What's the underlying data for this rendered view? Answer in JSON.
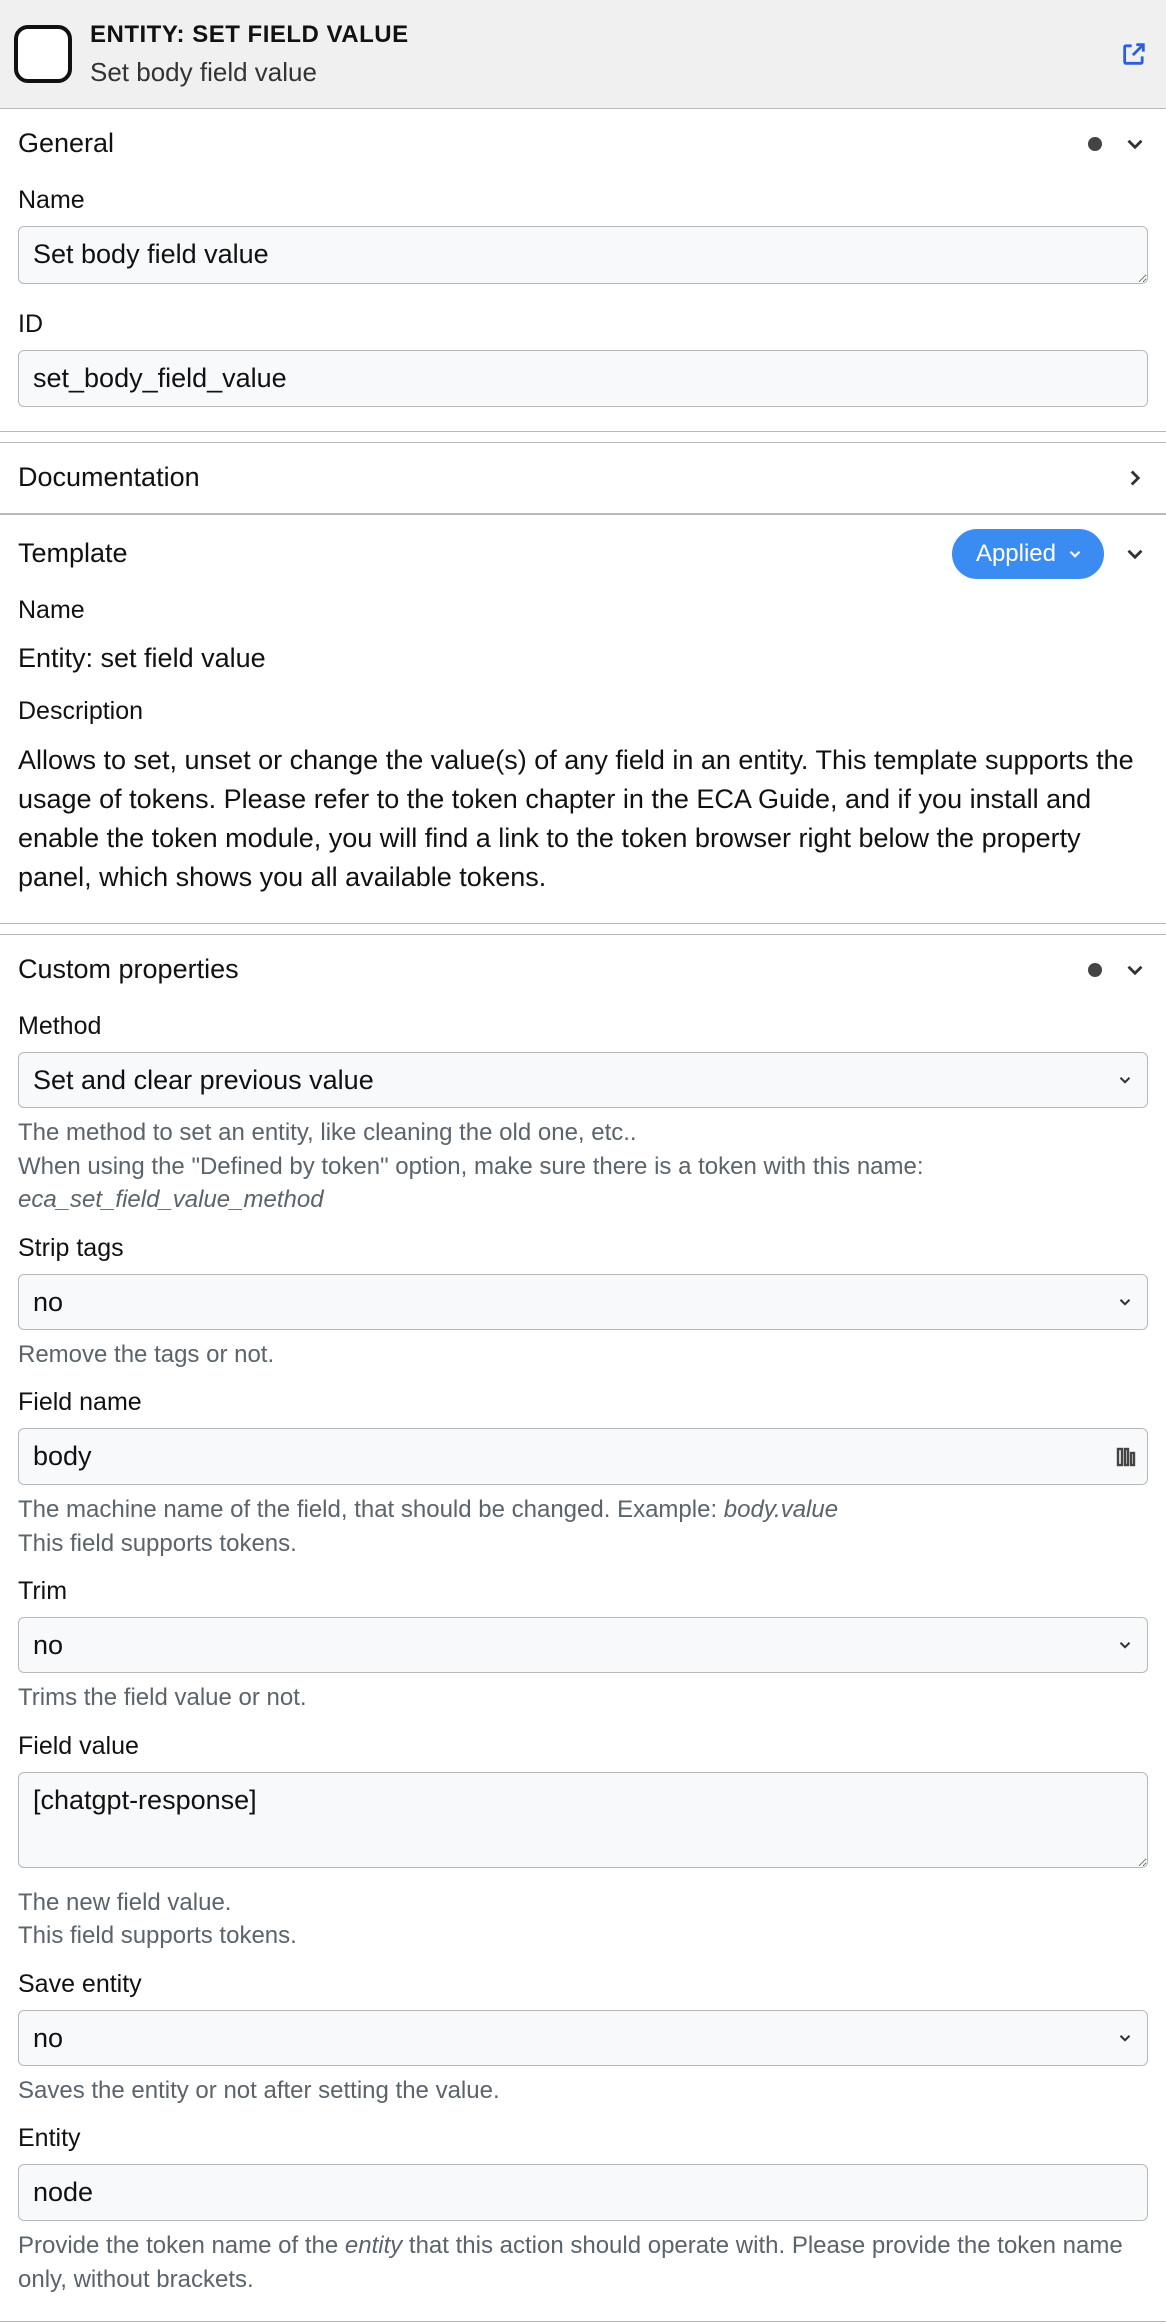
{
  "header": {
    "kicker": "ENTITY: SET FIELD VALUE",
    "subtitle": "Set body field value"
  },
  "sections": {
    "general": {
      "title": "General",
      "name_label": "Name",
      "name_value": "Set body field value",
      "id_label": "ID",
      "id_value": "set_body_field_value"
    },
    "documentation": {
      "title": "Documentation"
    },
    "template": {
      "title": "Template",
      "badge_label": "Applied",
      "name_label": "Name",
      "name_value": "Entity: set field value",
      "desc_label": "Description",
      "desc_value": "Allows to set, unset or change the value(s) of any field in an entity. This template supports the usage of tokens. Please refer to the token chapter in the ECA Guide, and if you install and enable the token module, you will find a link to the token browser right below the property panel, which shows you all available tokens."
    },
    "custom": {
      "title": "Custom properties",
      "method": {
        "label": "Method",
        "value": "Set and clear previous value",
        "help_line1": "The method to set an entity, like cleaning the old one, etc..",
        "help_line2_a": "When using the \"Defined by token\" option, make sure there is a token with this name: ",
        "help_line2_token": "eca_set_field_value_method"
      },
      "strip_tags": {
        "label": "Strip tags",
        "value": "no",
        "help": "Remove the tags or not."
      },
      "field_name": {
        "label": "Field name",
        "value": "body",
        "help_a": "The machine name of the field, that should be changed. Example: ",
        "help_example": "body.value",
        "help_b": "This field supports tokens."
      },
      "trim": {
        "label": "Trim",
        "value": "no",
        "help": "Trims the field value or not."
      },
      "field_value": {
        "label": "Field value",
        "value": "[chatgpt-response]",
        "help_a": "The new field value.",
        "help_b": "This field supports tokens."
      },
      "save_entity": {
        "label": "Save entity",
        "value": "no",
        "help": "Saves the entity or not after setting the value."
      },
      "entity": {
        "label": "Entity",
        "value": "node",
        "help_a": "Provide the token name of the ",
        "help_em": "entity",
        "help_b": " that this action should operate with. Please provide the token name only, without brackets."
      }
    }
  }
}
